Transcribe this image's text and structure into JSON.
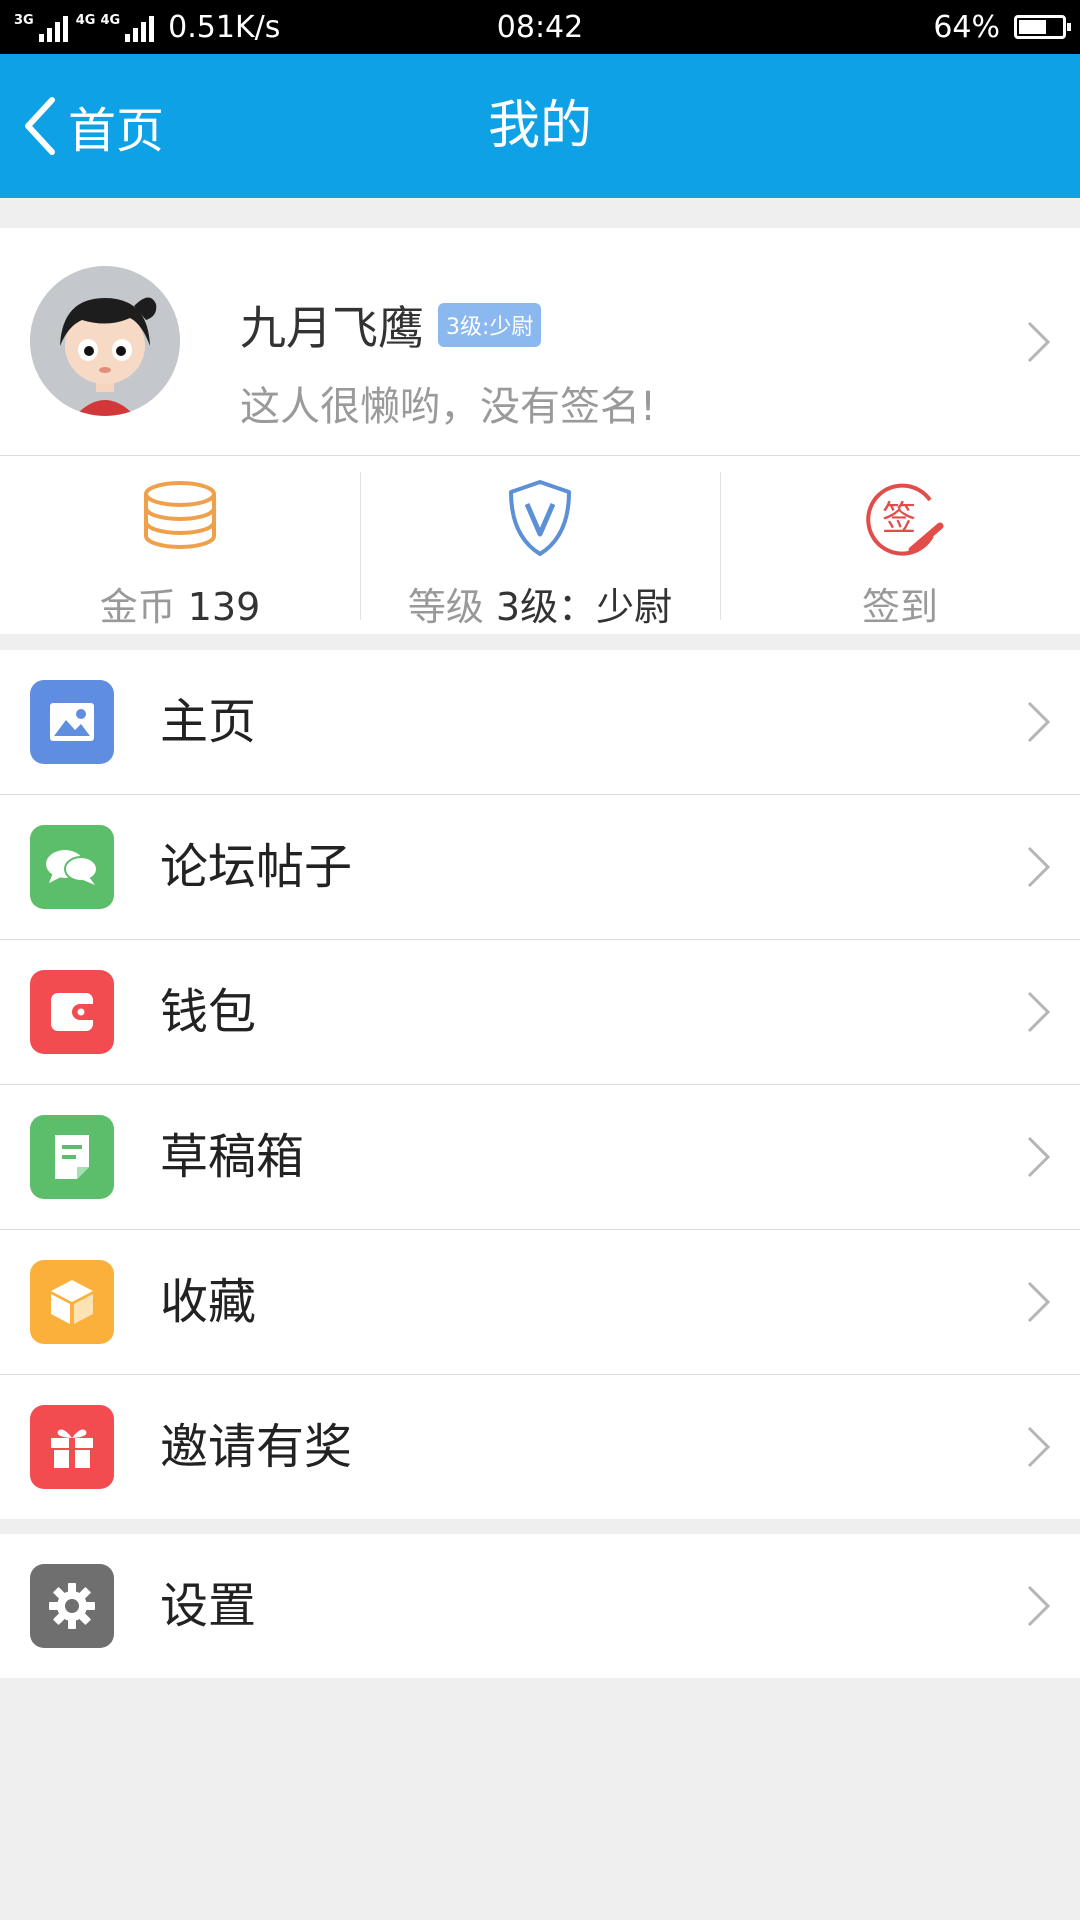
{
  "status_bar": {
    "network_1": "3G",
    "network_2": "4G",
    "network_3": "4G",
    "speed": "0.51K/s",
    "time": "08:42",
    "battery": "64%",
    "battery_level": 0.64
  },
  "header": {
    "back_label": "首页",
    "title": "我的"
  },
  "profile": {
    "username": "九月飞鹰",
    "badge": "3级:少尉",
    "signature": "这人很懒哟，没有签名!"
  },
  "stats": {
    "coins_label": "金币",
    "coins_value": "139",
    "level_label": "等级",
    "level_value": "3级：少尉",
    "checkin_label": "签到",
    "checkin_icon_text": "签"
  },
  "menu": [
    {
      "label": "主页",
      "icon": "image-icon",
      "color": "#5f8ee0"
    },
    {
      "label": "论坛帖子",
      "icon": "chat-bubbles-icon",
      "color": "#5cbd6b"
    },
    {
      "label": "钱包",
      "icon": "wallet-icon",
      "color": "#f24c51"
    },
    {
      "label": "草稿箱",
      "icon": "draft-document-icon",
      "color": "#5cbd6b"
    },
    {
      "label": "收藏",
      "icon": "box-icon",
      "color": "#fbb03b"
    },
    {
      "label": "邀请有奖",
      "icon": "gift-icon",
      "color": "#f24c51"
    }
  ],
  "settings": {
    "label": "设置",
    "icon": "gear-icon",
    "color": "#6f6f6f"
  }
}
